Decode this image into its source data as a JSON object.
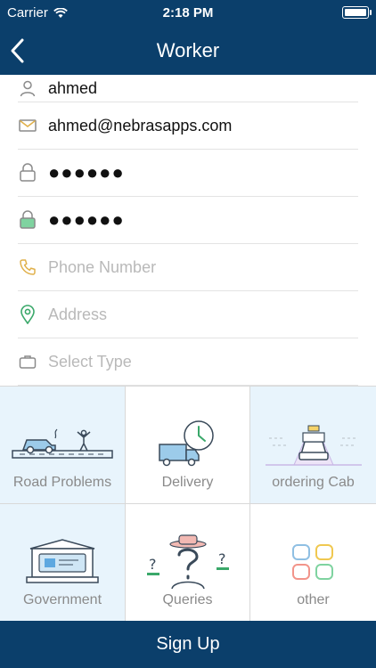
{
  "status_bar": {
    "carrier": "Carrier",
    "time": "2:18 PM"
  },
  "nav": {
    "title": "Worker",
    "back_icon": "chevron-left-icon"
  },
  "form": {
    "name": {
      "value": "ahmed",
      "icon": "user-icon"
    },
    "email": {
      "value": "ahmed@nebrasapps.com",
      "icon": "mail-icon"
    },
    "password": {
      "value": "●●●●●●",
      "icon": "lock-icon"
    },
    "confirm_password": {
      "value": "●●●●●●",
      "icon": "lock-green-icon"
    },
    "phone": {
      "placeholder": "Phone Number",
      "icon": "phone-icon"
    },
    "address": {
      "placeholder": "Address",
      "icon": "location-pin-icon"
    },
    "type": {
      "placeholder": "Select Type",
      "icon": "briefcase-icon"
    }
  },
  "categories": [
    {
      "label": "Road Problems",
      "icon": "road-problems-icon",
      "selected": true
    },
    {
      "label": "Delivery",
      "icon": "delivery-truck-icon",
      "selected": false
    },
    {
      "label": "ordering Cab",
      "icon": "taxi-icon",
      "selected": true
    },
    {
      "label": "Government",
      "icon": "government-building-icon",
      "selected": true
    },
    {
      "label": "Queries",
      "icon": "question-person-icon",
      "selected": false
    },
    {
      "label": "other",
      "icon": "other-squares-icon",
      "selected": false
    }
  ],
  "footer": {
    "signup_label": "Sign Up"
  },
  "colors": {
    "brand": "#0b3f6b",
    "selected_cell": "#e8f4fc",
    "divider": "#e3e3e3"
  }
}
